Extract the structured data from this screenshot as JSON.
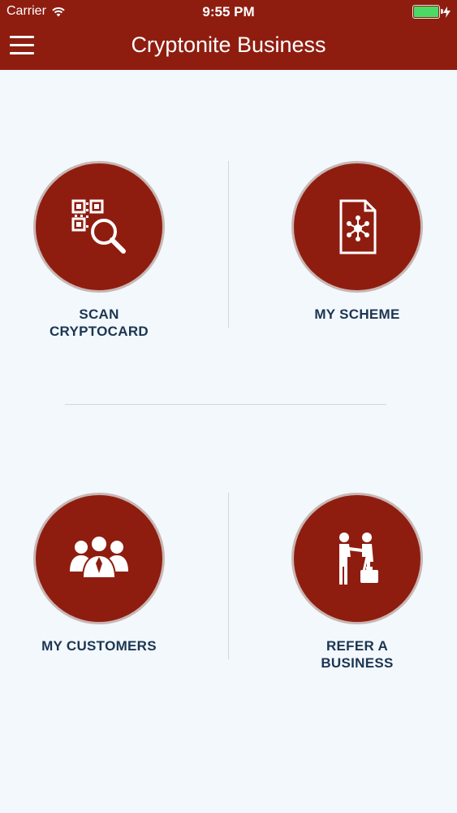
{
  "status_bar": {
    "carrier": "Carrier",
    "time": "9:55 PM"
  },
  "nav": {
    "title": "Cryptonite Business"
  },
  "tiles": [
    {
      "label": "SCAN\nCRYPTOCARD",
      "icon": "qr-scan-icon"
    },
    {
      "label": "MY SCHEME",
      "icon": "scheme-document-icon"
    },
    {
      "label": "MY CUSTOMERS",
      "icon": "customers-group-icon"
    },
    {
      "label": "REFER A\nBUSINESS",
      "icon": "handshake-icon"
    }
  ],
  "colors": {
    "primary": "#8e1d10",
    "label": "#1c3552",
    "background": "#f2f8fc"
  }
}
